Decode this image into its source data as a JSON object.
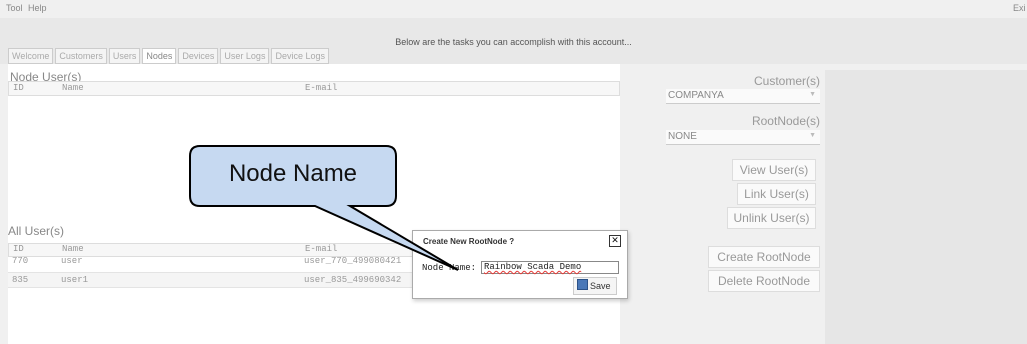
{
  "menu": {
    "items": [
      "Tool",
      "Help"
    ],
    "exit_label": "Exi"
  },
  "banner": {
    "text": "Below are the tasks you can accomplish with this account..."
  },
  "tabs": [
    "Welcome",
    "Customers",
    "Users",
    "Nodes",
    "Devices",
    "User Logs",
    "Device Logs"
  ],
  "active_tab": "Nodes",
  "node_users": {
    "title": "Node User(s)",
    "columns": [
      "ID",
      "Name",
      "E-mail"
    ],
    "rows": []
  },
  "all_users": {
    "title": "All User(s)",
    "columns": [
      "ID",
      "Name",
      "E-mail"
    ],
    "rows": [
      {
        "id": "770",
        "name": "user",
        "email": "user_770_499080421"
      },
      {
        "id": "835",
        "name": "user1",
        "email": "user_835_499690342"
      }
    ]
  },
  "sidebar": {
    "customer_label": "Customer(s)",
    "customer_value": "COMPANYA",
    "rootnode_label": "RootNode(s)",
    "rootnode_value": "NONE",
    "view_users": "View User(s)",
    "link_users": "Link User(s)",
    "unlink_users": "Unlink User(s)",
    "create_rootnode": "Create RootNode",
    "delete_rootnode": "Delete RootNode"
  },
  "dialog": {
    "title": "Create New RootNode ?",
    "field_label": "Node Name:",
    "field_value": "Rainbow Scada Demo",
    "save_label": "Save"
  },
  "callout": {
    "text": "Node Name"
  },
  "colors": {
    "callout_fill": "#c6d9f1",
    "callout_stroke": "#000000",
    "spellcheck_underline": "#e53935"
  }
}
